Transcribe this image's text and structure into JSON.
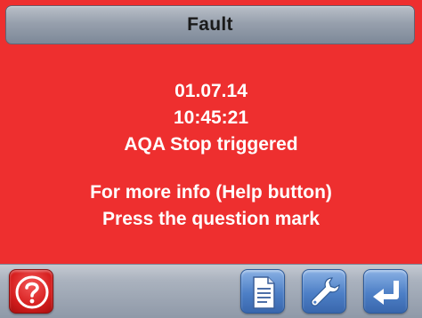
{
  "header": {
    "title": "Fault"
  },
  "message": {
    "date": "01.07.14",
    "time": "10:45:21",
    "event": "AQA Stop triggered",
    "help_line_1": "For more info (Help button)",
    "help_line_2": "Press the question mark"
  },
  "toolbar": {
    "help_icon": "question-mark-icon",
    "doc_icon": "document-icon",
    "wrench_icon": "wrench-icon",
    "enter_icon": "enter-arrow-icon"
  },
  "colors": {
    "alarm_background": "#ee2f2f",
    "header_bar": "#97a0ad",
    "button_blue": "#4d7fc6",
    "help_red": "#d61e1e",
    "text_white": "#ffffff"
  }
}
